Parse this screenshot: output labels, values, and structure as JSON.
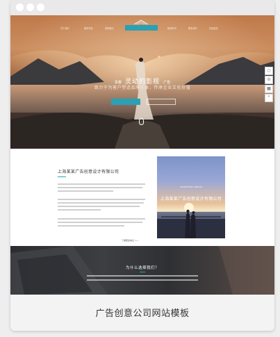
{
  "caption": "广告创意公司网站模板",
  "nav": {
    "items": [
      "关于我们",
      "服务项目",
      "案例展示",
      "新闻资讯",
      "联系我们",
      "在线留言"
    ],
    "active": ""
  },
  "hero": {
    "title_pre": "青春",
    "title_main": "灵动的影视",
    "title_post": "广告",
    "subtitle": "致力于为客户塑造品牌形象，传承企业文化价值",
    "button_secondary": ""
  },
  "about": {
    "title": "上海某某广告创意设计有限公司",
    "more_link": "了解更多信息 >>",
    "image_caption_small": "ADVERTISING DESIGN",
    "image_caption": "上海某某广告创意设计有限公司"
  },
  "why": {
    "title": "为什么选择我们？"
  },
  "colors": {
    "accent": "#2aa1b4"
  },
  "side_tools_icons": [
    "chat-icon",
    "phone-icon",
    "qrcode-icon",
    "top-icon"
  ]
}
